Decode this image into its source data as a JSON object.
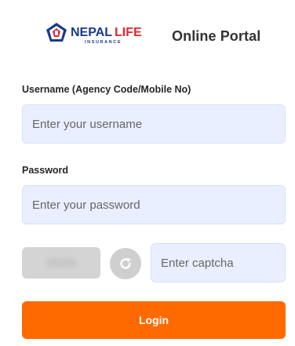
{
  "header": {
    "brand_name": "NEPAL LIFE",
    "brand_primary": "NEPAL",
    "brand_secondary": "LIFE",
    "brand_tagline": "INSURANCE",
    "portal_title": "Online Portal"
  },
  "form": {
    "username": {
      "label": "Username (Agency Code/Mobile No)",
      "placeholder": "Enter your username",
      "value": ""
    },
    "password": {
      "label": "Password",
      "placeholder": "Enter your password",
      "value": ""
    },
    "captcha": {
      "placeholder": "Enter captcha",
      "value": "",
      "refresh_icon": "refresh-icon"
    },
    "login_label": "Login"
  },
  "colors": {
    "brand_blue": "#1a3a8a",
    "brand_red": "#e3262c",
    "input_bg": "#e9efff",
    "button_orange": "#ff6a00"
  }
}
